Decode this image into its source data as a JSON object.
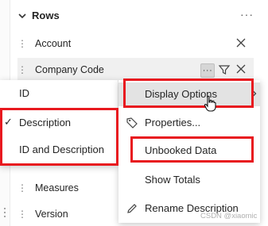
{
  "rows_panel": {
    "title": "Rows",
    "items": [
      {
        "label": "Account"
      },
      {
        "label": "Company Code"
      },
      {
        "label": "Measures"
      },
      {
        "label": "Version"
      }
    ]
  },
  "context_menu": {
    "items": [
      {
        "label": "Display Options",
        "icon": "none",
        "has_submenu": true
      },
      {
        "label": "Properties...",
        "icon": "tag-icon"
      },
      {
        "label": "Unbooked Data",
        "icon": "none"
      },
      {
        "label": "Show Totals",
        "icon": "none"
      },
      {
        "label": "Rename Description",
        "icon": "pencil-icon"
      }
    ]
  },
  "display_submenu": {
    "items": [
      {
        "label": "ID",
        "checked": false
      },
      {
        "label": "Description",
        "checked": true
      },
      {
        "label": "ID and Description",
        "checked": false
      }
    ]
  },
  "watermark": "CSDN @xiaomic",
  "colors": {
    "highlight_border": "#e8191f",
    "menu_hover": "#e3e3e3"
  }
}
